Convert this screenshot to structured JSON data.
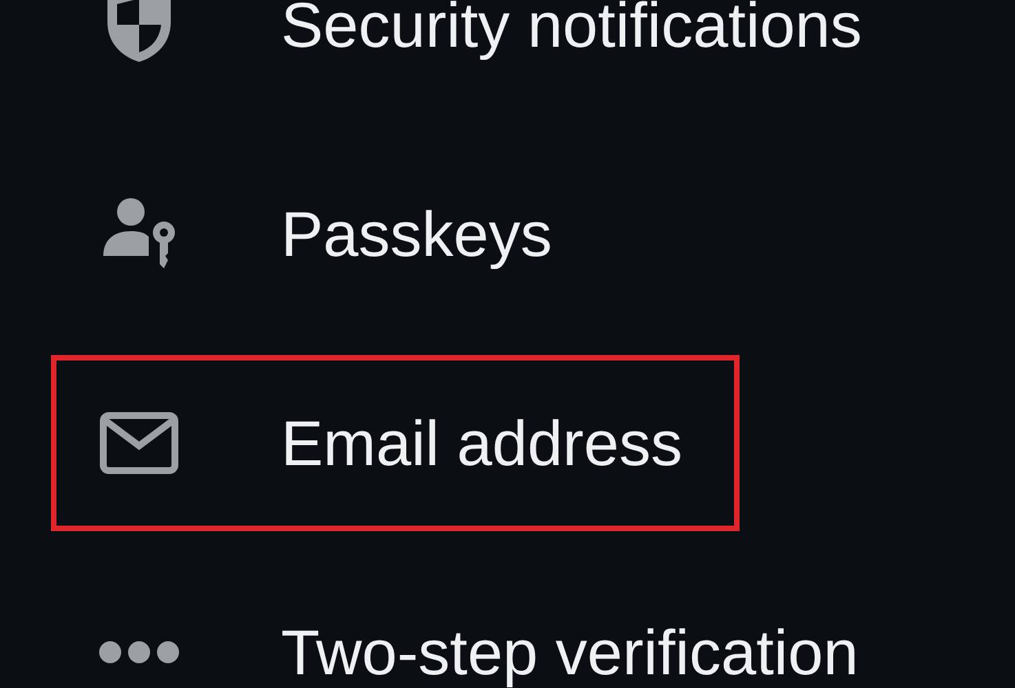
{
  "items": [
    {
      "kind": "shield",
      "label": "Security notifications",
      "highlighted": false
    },
    {
      "kind": "passkey",
      "label": "Passkeys",
      "highlighted": false
    },
    {
      "kind": "email",
      "label": "Email address",
      "highlighted": true
    },
    {
      "kind": "password",
      "label": "Two-step verification",
      "highlighted": false
    }
  ]
}
